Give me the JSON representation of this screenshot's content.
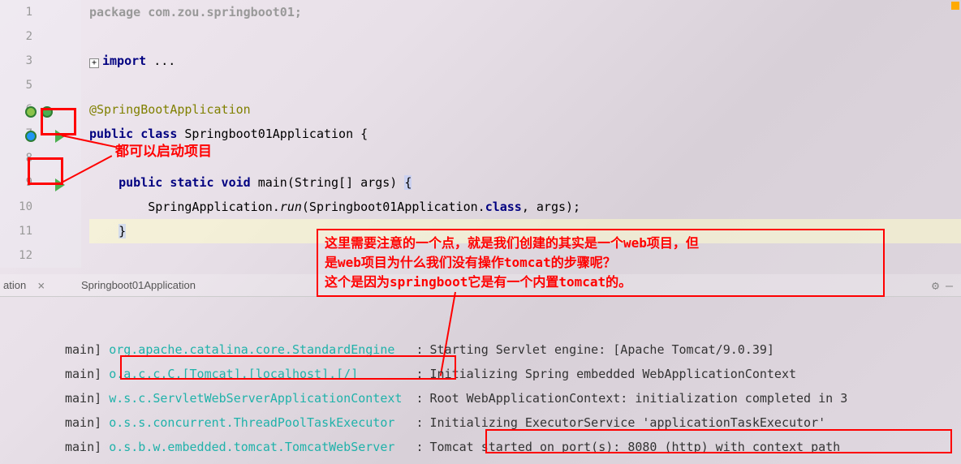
{
  "editor": {
    "line1": {
      "num": "1",
      "text": "package com.zou.springboot01;"
    },
    "line2": {
      "num": "2",
      "text": ""
    },
    "line3": {
      "num": "3",
      "kw": "import",
      "text": " ..."
    },
    "line5": {
      "num": "5",
      "text": ""
    },
    "line6": {
      "num": "6",
      "annotation": "@SpringBootApplication"
    },
    "line7": {
      "num": "7",
      "kw1": "public class",
      "cls": " Springboot01Application {"
    },
    "line8": {
      "num": "8",
      "text": ""
    },
    "line9": {
      "num": "9",
      "kw1": "public static void",
      "method": " main",
      "params": "(String[] args) ",
      "brace": "{"
    },
    "line10": {
      "num": "10",
      "prefix": "        SpringApplication.",
      "method": "run",
      "args1": "(Springboot01Application.",
      "kw": "class",
      "args2": ", args);"
    },
    "line11": {
      "num": "11",
      "brace": "}"
    },
    "line12": {
      "num": "12",
      "text": ""
    }
  },
  "annotations": {
    "top_label": "都可以启动项目",
    "mid_box_line1": "这里需要注意的一个点，就是我们创建的其实是一个web项目，但",
    "mid_box_line2": "是web项目为什么我们没有操作tomcat的步骤呢？",
    "mid_box_line3": "这个是因为springboot它是有一个内置tomcat的。"
  },
  "tab": {
    "left_label": "ation",
    "title": "Springboot01Application"
  },
  "console": {
    "lines": [
      {
        "prefix": "main] ",
        "logger": "org.apache.catalina.core.StandardEngine  ",
        "msg": "Starting Servlet engine: [Apache Tomcat/9.0.39]"
      },
      {
        "prefix": "main] ",
        "logger": "o.a.c.c.C.[Tomcat].[localhost].[/]       ",
        "msg": "Initializing Spring embedded WebApplicationContext"
      },
      {
        "prefix": "main] ",
        "logger": "w.s.c.ServletWebServerApplicationContext ",
        "msg": "Root WebApplicationContext: initialization completed in 3"
      },
      {
        "prefix": "main] ",
        "logger": "o.s.s.concurrent.ThreadPoolTaskExecutor  ",
        "msg": "Initializing ExecutorService 'applicationTaskExecutor'"
      },
      {
        "prefix": "main] ",
        "logger": "o.s.b.w.embedded.tomcat.TomcatWebServer  ",
        "msg": "Tomcat started on port(s): 8080 (http) with context path"
      }
    ]
  }
}
